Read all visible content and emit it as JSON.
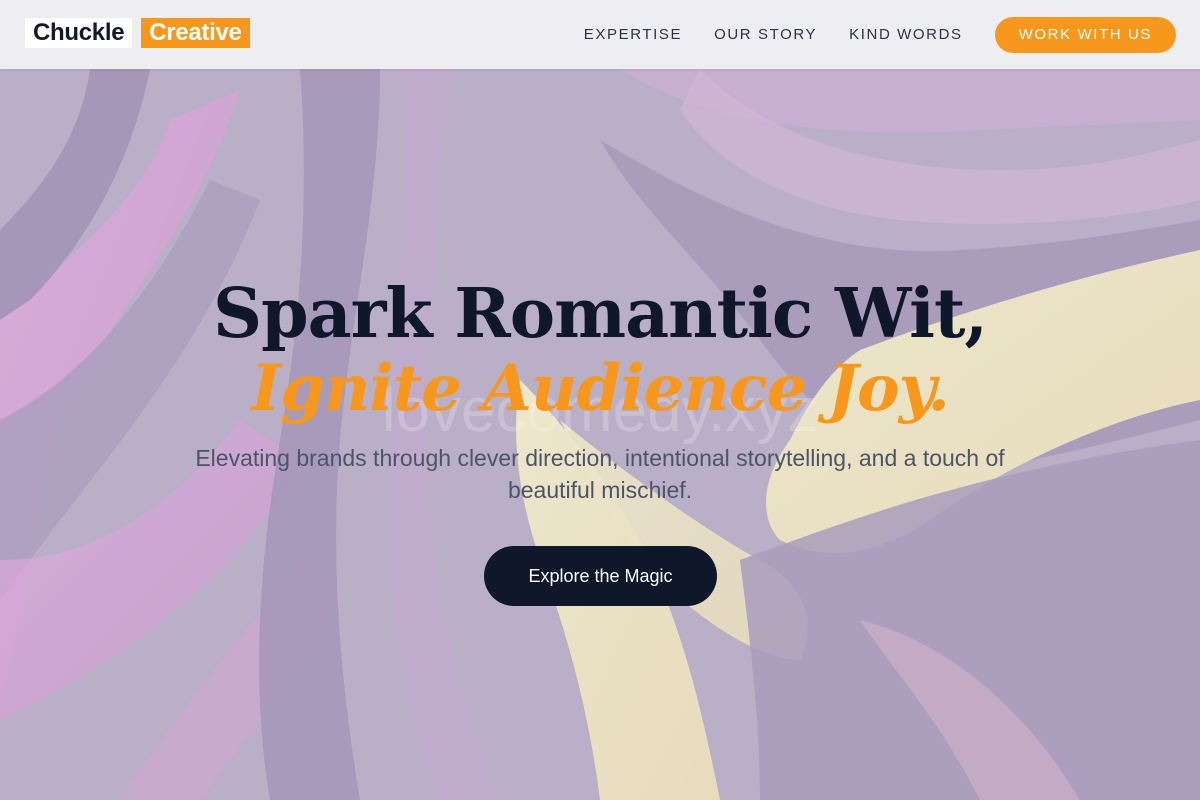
{
  "brand": {
    "name_primary": "Chuckle",
    "name_accent": "Creative",
    "accent_color": "#f7981d",
    "dark_color": "#0f172a"
  },
  "nav": {
    "links": [
      {
        "label": "EXPERTISE"
      },
      {
        "label": "OUR STORY"
      },
      {
        "label": "KIND WORDS"
      }
    ],
    "cta_label": "WORK WITH US"
  },
  "hero": {
    "title_line1": "Spark Romantic Wit,",
    "title_line2": "Ignite Audience Joy.",
    "subtitle": "Elevating brands through clever direction, intentional storytelling, and a touch of beautiful mischief.",
    "cta_label": "Explore the Magic",
    "watermark": "lovecomedy.xyz"
  }
}
